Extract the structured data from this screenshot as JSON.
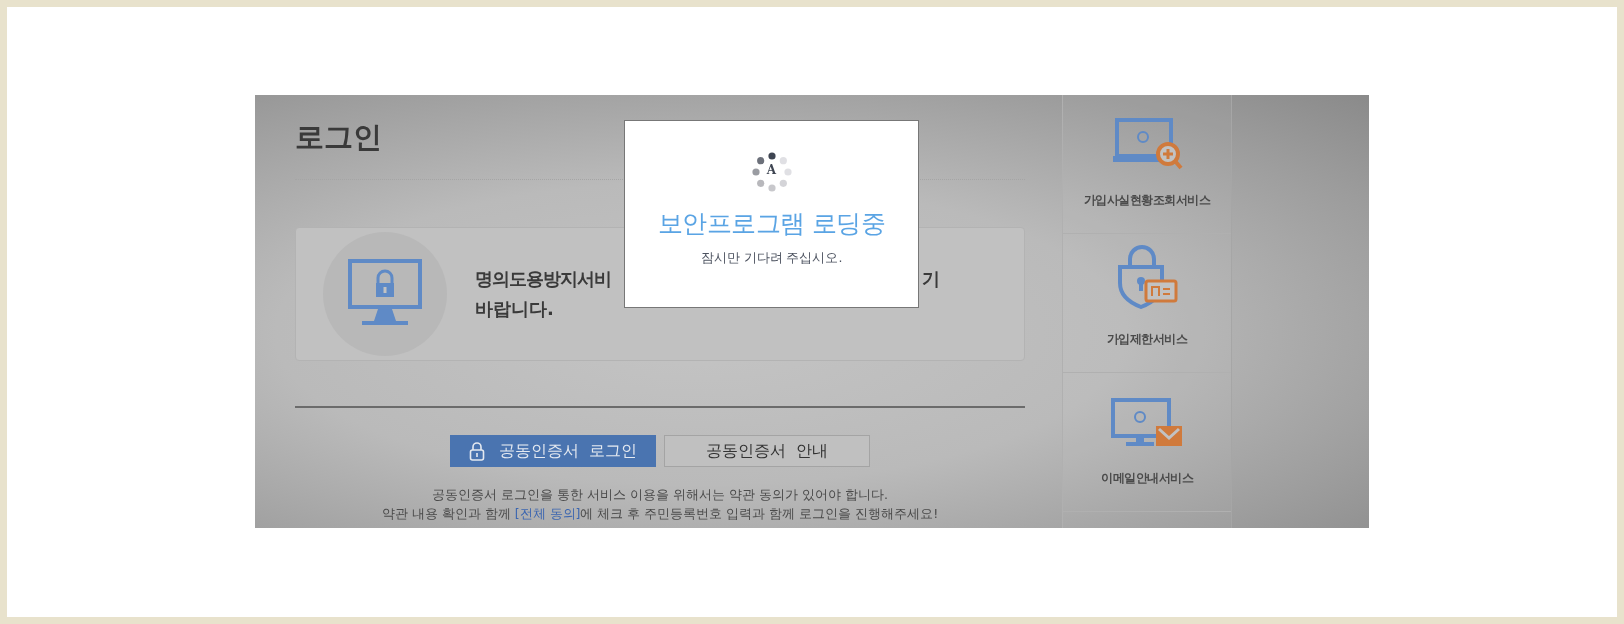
{
  "page": {
    "title": "로그인"
  },
  "notice": {
    "line_start": "명의도용방지서비",
    "line_end": "기",
    "line_2": "바랍니다."
  },
  "buttons": [
    {
      "label": "공동인증서  로그인",
      "kind": "primary"
    },
    {
      "label": "공동인증서  안내",
      "kind": "secondary"
    }
  ],
  "terms": {
    "line_1": "공동인증서 로그인을 통한 서비스 이용을 위해서는 약관 동의가 있어야 합니다.",
    "line_2_before": "약관 내용 확인과 함께 ",
    "line_2_link": "[전체 동의]",
    "line_2_after": "에 체크 후 주민등록번호 입력과 함께 로그인을 진행해주세요!"
  },
  "sidebar": {
    "items": [
      {
        "label": "가입사실현황조회서비스",
        "kind": "lookup"
      },
      {
        "label": "가입제한서비스",
        "kind": "restrict"
      },
      {
        "label": "이메일안내서비스",
        "kind": "email"
      }
    ]
  },
  "modal": {
    "spinner_letter": "A",
    "title": "보안프로그램 로딩중",
    "message": "잠시만 기다려 주십시오."
  }
}
